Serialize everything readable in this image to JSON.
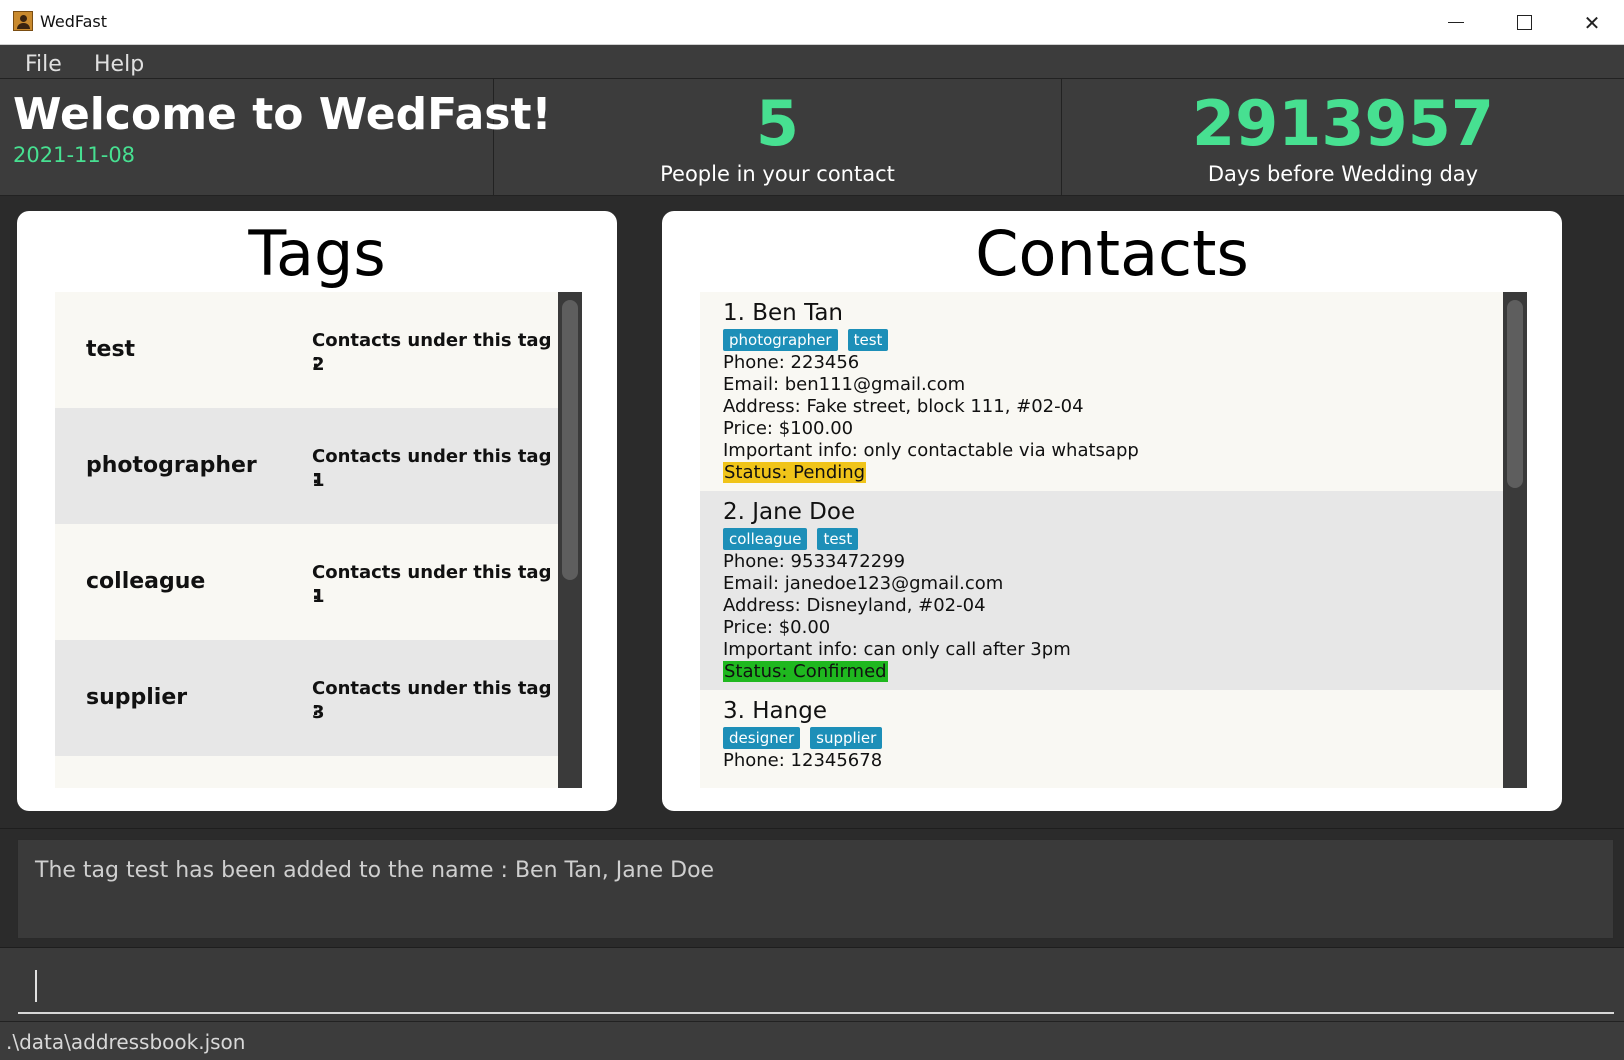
{
  "window": {
    "title": "WedFast",
    "minimize_glyph": "",
    "maximize_glyph": "",
    "close_glyph": "✕"
  },
  "menu": {
    "file": "File",
    "help": "Help"
  },
  "header": {
    "welcome": "Welcome to WedFast!",
    "date": "2021-11-08",
    "people_count": "5",
    "people_label": "People in your contact",
    "days_count": "2913957",
    "days_label": "Days before Wedding day"
  },
  "tags_panel": {
    "title": "Tags",
    "count_label": "Contacts under this tag :",
    "items": [
      {
        "name": "test",
        "count": "2"
      },
      {
        "name": "photographer",
        "count": "1"
      },
      {
        "name": "colleague",
        "count": "1"
      },
      {
        "name": "supplier",
        "count": "3"
      }
    ]
  },
  "contacts_panel": {
    "title": "Contacts",
    "items": [
      {
        "name": "1.  Ben Tan",
        "tags": [
          "photographer",
          "test"
        ],
        "phone": "Phone: 223456",
        "email": "Email: ben111@gmail.com",
        "address": "Address: Fake street, block 111, #02-04",
        "price": "Price: $100.00",
        "info": "Important info: only contactable via whatsapp",
        "status": "Status: Pending",
        "status_color": "#f0c419"
      },
      {
        "name": "2.  Jane Doe",
        "tags": [
          "colleague",
          "test"
        ],
        "phone": "Phone: 9533472299",
        "email": "Email: janedoe123@gmail.com",
        "address": "Address: Disneyland, #02-04",
        "price": "Price: $0.00",
        "info": "Important info: can only call after 3pm",
        "status": "Status: Confirmed",
        "status_color": "#1fb81f"
      },
      {
        "name": "3.  Hange",
        "tags": [
          "designer",
          "supplier"
        ],
        "phone": "Phone: 12345678"
      }
    ]
  },
  "result": {
    "text": "The tag test has been added to the name : Ben Tan, Jane Doe"
  },
  "command": {
    "value": "",
    "placeholder": ""
  },
  "statusbar": {
    "path": ".\\data\\addressbook.json"
  },
  "colors": {
    "accent_green": "#47e091",
    "tag_chip": "#1d8fb8",
    "background": "#2b2b2b"
  }
}
